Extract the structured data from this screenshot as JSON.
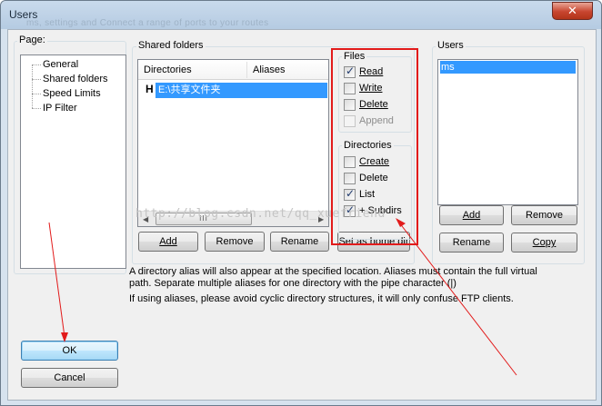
{
  "window": {
    "title": "Users",
    "ghost_text": "ms, settings and Connect a range of ports to your routes",
    "close_glyph": "✕"
  },
  "page_group": {
    "label": "Page:",
    "items": [
      "General",
      "Shared folders",
      "Speed Limits",
      "IP Filter"
    ]
  },
  "buttons": {
    "ok": "OK",
    "cancel": "Cancel"
  },
  "shared_folders": {
    "label": "Shared folders",
    "col_directories": "Directories",
    "col_aliases": "Aliases",
    "row_marker": "H",
    "row_path": "E:\\共享文件夹",
    "scroll_thumb": "III",
    "add": "Add",
    "remove": "Remove",
    "rename": "Rename",
    "set_home": "Set as home dir"
  },
  "files": {
    "label": "Files",
    "read": {
      "label": "Read",
      "checked": true
    },
    "write": {
      "label": "Write",
      "checked": false
    },
    "delete": {
      "label": "Delete",
      "checked": false
    },
    "append": {
      "label": "Append",
      "checked": false,
      "disabled": true
    }
  },
  "directories": {
    "label": "Directories",
    "create": {
      "label": "Create",
      "checked": false
    },
    "delete": {
      "label": "Delete",
      "checked": false
    },
    "list": {
      "label": "List",
      "checked": true
    },
    "subdirs": {
      "label": "+ Subdirs",
      "checked": true
    }
  },
  "users": {
    "label": "Users",
    "items": [
      "ms"
    ],
    "add": "Add",
    "remove": "Remove",
    "rename": "Rename",
    "copy": "Copy"
  },
  "notes": {
    "line1": "A directory alias will also appear at the specified location. Aliases must contain the full virtual",
    "line2": "path. Separate multiple aliases for one directory with the pipe character (|)",
    "line3": "If using aliases, please avoid cyclic directory structures, it will only confuse FTP clients."
  },
  "watermark": "http://blog.csdn.net/qq_xuefriend",
  "colors": {
    "selection": "#3399ff",
    "annotation": "#e21b1b"
  }
}
